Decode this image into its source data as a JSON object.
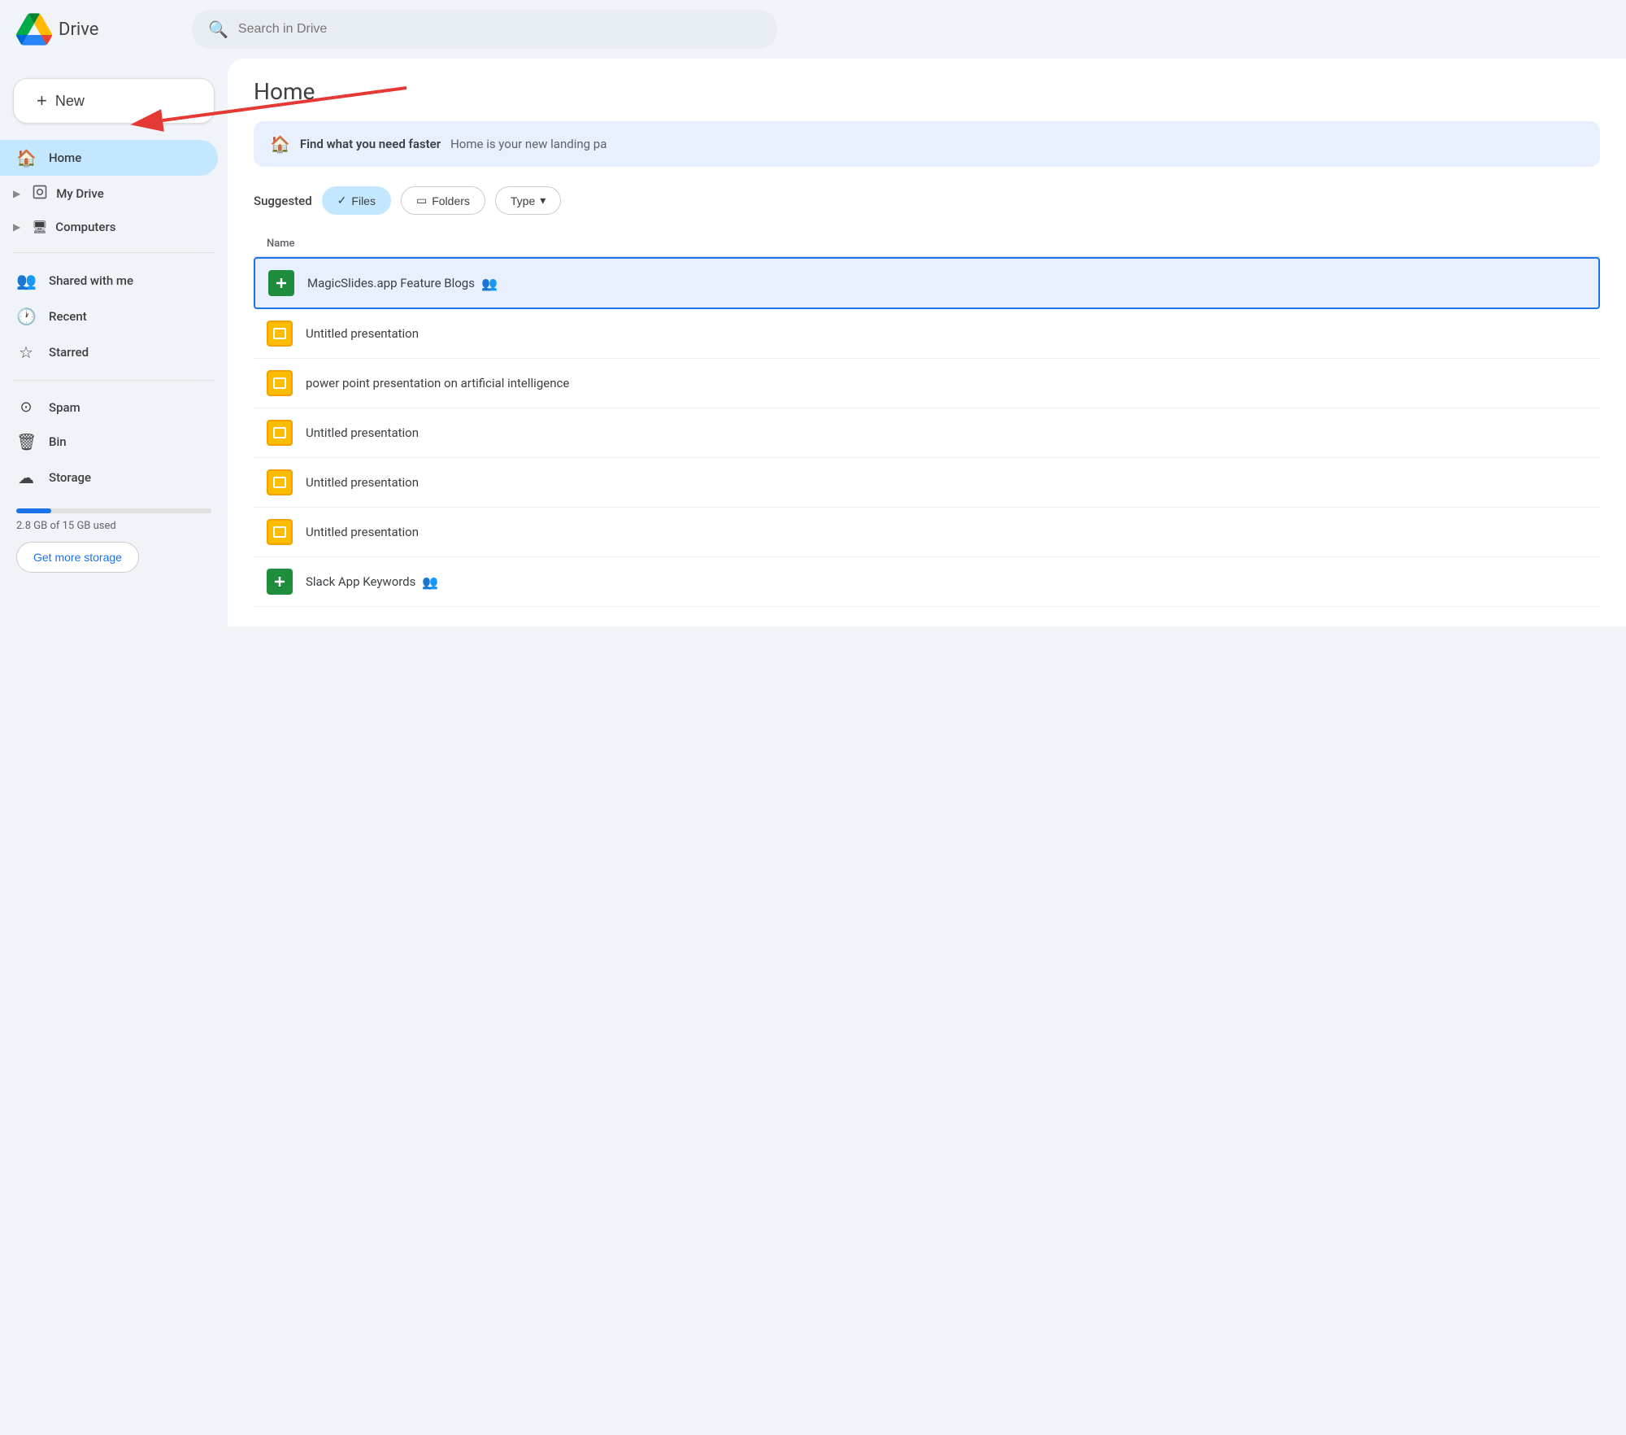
{
  "header": {
    "logo_text": "Drive",
    "search_placeholder": "Search in Drive"
  },
  "sidebar": {
    "new_button_label": "New",
    "items": [
      {
        "id": "home",
        "label": "Home",
        "icon": "🏠",
        "active": true,
        "has_arrow": false
      },
      {
        "id": "my-drive",
        "label": "My Drive",
        "icon": "💾",
        "active": false,
        "has_arrow": true
      },
      {
        "id": "computers",
        "label": "Computers",
        "icon": "🖥",
        "active": false,
        "has_arrow": true
      },
      {
        "id": "shared-with-me",
        "label": "Shared with me",
        "icon": "👥",
        "active": false,
        "has_arrow": false
      },
      {
        "id": "recent",
        "label": "Recent",
        "icon": "🕐",
        "active": false,
        "has_arrow": false
      },
      {
        "id": "starred",
        "label": "Starred",
        "icon": "☆",
        "active": false,
        "has_arrow": false
      },
      {
        "id": "spam",
        "label": "Spam",
        "icon": "⊙",
        "active": false,
        "has_arrow": false
      },
      {
        "id": "bin",
        "label": "Bin",
        "icon": "🗑",
        "active": false,
        "has_arrow": false
      },
      {
        "id": "storage",
        "label": "Storage",
        "icon": "☁",
        "active": false,
        "has_arrow": false
      }
    ],
    "storage": {
      "used": "2.8 GB of 15 GB used",
      "percent": 18,
      "get_more_label": "Get more storage"
    }
  },
  "main": {
    "page_title": "Home",
    "banner": {
      "icon": "🏠",
      "title": "Find what you need faster",
      "description": "Home is your new landing pa"
    },
    "filter": {
      "label": "Suggested",
      "buttons": [
        {
          "id": "files",
          "label": "Files",
          "active": true,
          "icon": "✓"
        },
        {
          "id": "folders",
          "label": "Folders",
          "active": false,
          "icon": "▭"
        },
        {
          "id": "type",
          "label": "Type",
          "active": false,
          "icon": "",
          "has_dropdown": true
        }
      ]
    },
    "table": {
      "header_label": "Name",
      "files": [
        {
          "id": 1,
          "name": "MagicSlides.app Feature Blogs",
          "icon_type": "green",
          "icon_symbol": "+",
          "shared": true,
          "selected": true
        },
        {
          "id": 2,
          "name": "Untitled presentation",
          "icon_type": "yellow",
          "icon_symbol": "▭",
          "shared": false,
          "selected": false
        },
        {
          "id": 3,
          "name": "power point presentation on artificial intelligence",
          "icon_type": "yellow",
          "icon_symbol": "▭",
          "shared": false,
          "selected": false
        },
        {
          "id": 4,
          "name": "Untitled presentation",
          "icon_type": "yellow",
          "icon_symbol": "▭",
          "shared": false,
          "selected": false
        },
        {
          "id": 5,
          "name": "Untitled presentation",
          "icon_type": "yellow",
          "icon_symbol": "▭",
          "shared": false,
          "selected": false
        },
        {
          "id": 6,
          "name": "Untitled presentation",
          "icon_type": "yellow",
          "icon_symbol": "▭",
          "shared": false,
          "selected": false
        },
        {
          "id": 7,
          "name": "Slack App Keywords",
          "icon_type": "green",
          "icon_symbol": "+",
          "shared": true,
          "selected": false
        }
      ]
    }
  },
  "arrow": {
    "label": "Arrow pointing to New button"
  }
}
